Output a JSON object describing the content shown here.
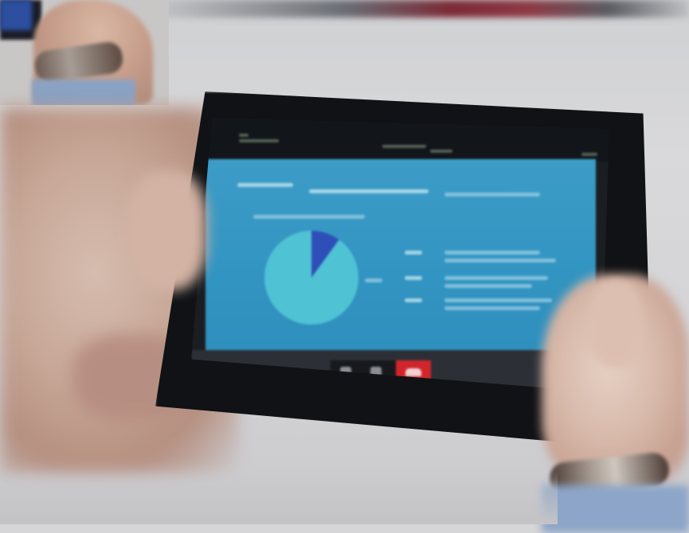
{
  "scene": {
    "table_color": "#d6d6d8",
    "tablet_bezel_color": "#101215",
    "slide_color": "#3395c2"
  },
  "tablet": {
    "pie": {
      "slice_color": "#2f4fb8",
      "rest_color": "#4fc2d4"
    },
    "controls": {
      "icons": [
        "mic-icon",
        "video-icon",
        "end-call-icon"
      ],
      "end_call_color": "#d0262b"
    }
  }
}
